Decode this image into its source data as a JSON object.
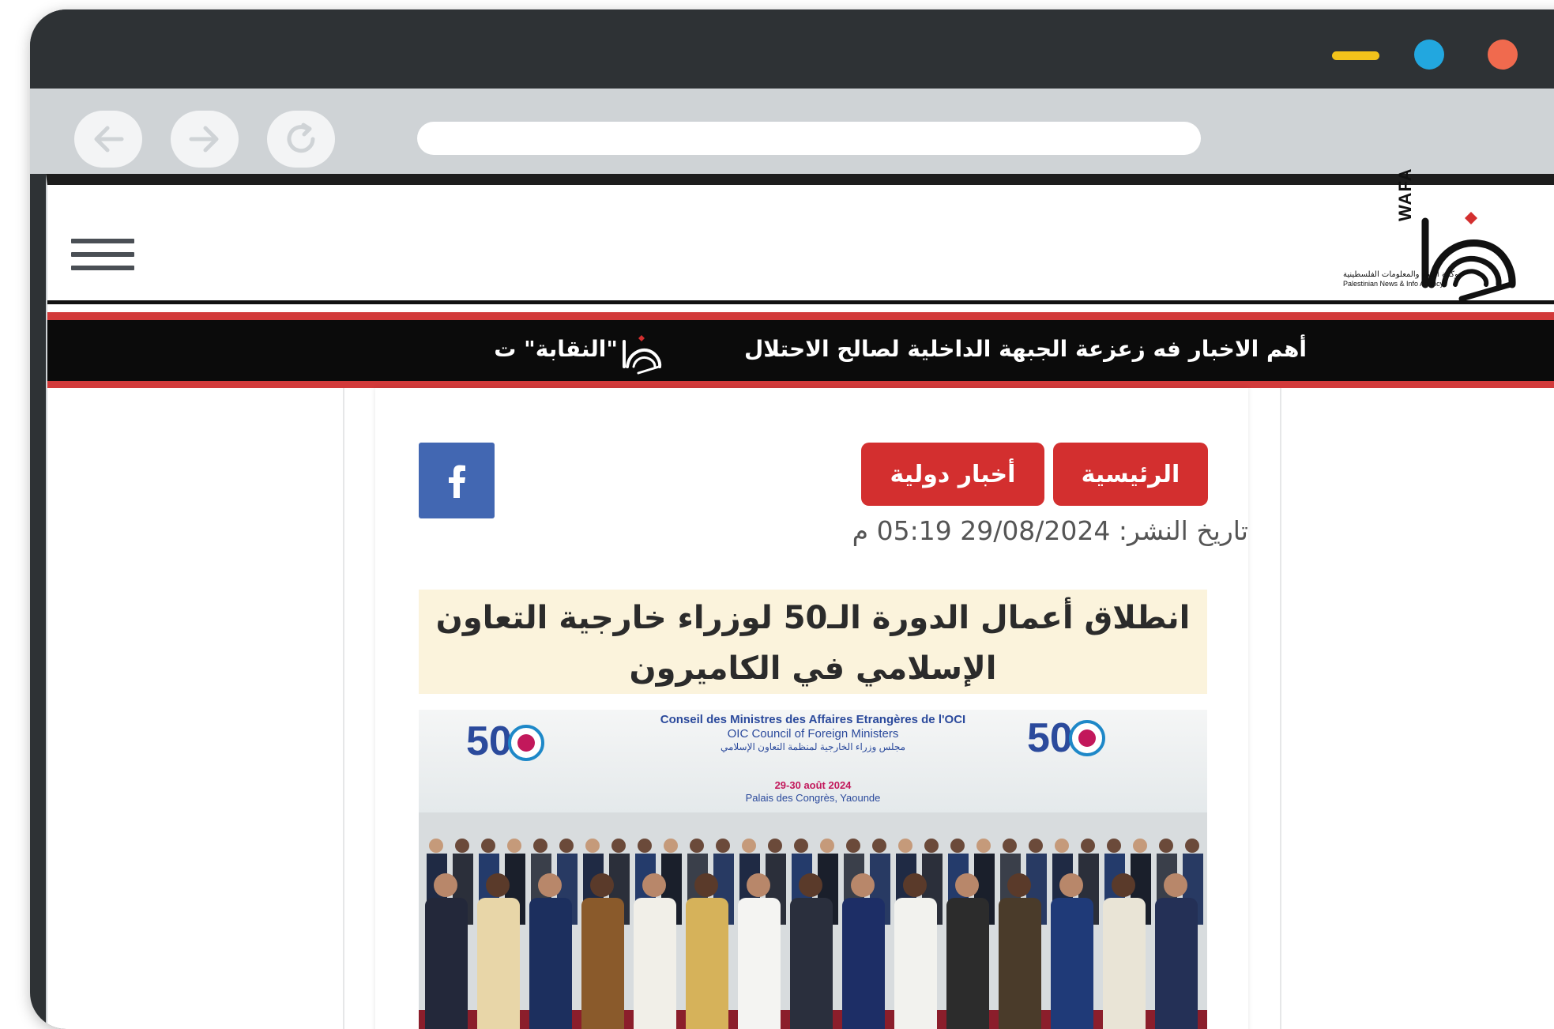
{
  "browser": {
    "colors": {
      "frame": "#2e3235",
      "toolbar": "#cfd3d6",
      "min": "#f2c31b",
      "max": "#22a7df",
      "close": "#f06a4e"
    },
    "nav_icons": [
      "back-arrow-icon",
      "forward-arrow-icon",
      "reload-icon"
    ],
    "address_value": ""
  },
  "site": {
    "logo": {
      "name": "WAFA",
      "caption_ar": "وكالة الأنباء والمعلومات الفلسطينية",
      "caption_en": "Palestinian News & Info Agency"
    },
    "ticker": {
      "item1": "أهم الاخبار فه زعزعة الجبهة الداخلية لصالح الاحتلال",
      "item2": "\"النقابة\" ت"
    },
    "colors": {
      "accent": "#d32f2f",
      "ticker_bg": "#0b0b0b",
      "facebook": "#4267b2",
      "headline_bg": "#fbf3dc"
    }
  },
  "article": {
    "breadcrumb": [
      "الرئيسية",
      "أخبار دولية"
    ],
    "date": "تاريخ النشر: 29/08/2024 05:19 م",
    "title": "انطلاق أعمال الدورة الـ50 لوزراء خارجية التعاون الإسلامي في الكاميرون",
    "photo_banner": {
      "line1": "Conseil des Ministres des Affaires Etrangères de l'OCI",
      "line2": "OIC Council of Foreign Ministers",
      "line3": "مجلس وزراء الخارجية لمنظمة التعاون الإسلامي",
      "dates": "29-30 août 2024",
      "venue": "Palais des Congrès, Yaounde",
      "emblem_number": "50"
    }
  }
}
